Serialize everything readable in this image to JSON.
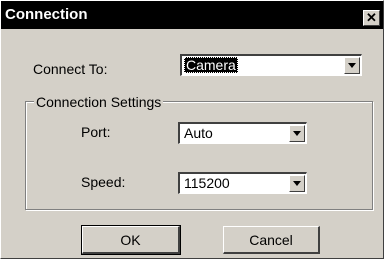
{
  "window": {
    "title": "Connection",
    "close_glyph": "✕"
  },
  "connect_to": {
    "label": "Connect To:",
    "value": "Camera"
  },
  "settings": {
    "legend": "Connection Settings",
    "port": {
      "label": "Port:",
      "value": "Auto"
    },
    "speed": {
      "label": "Speed:",
      "value": "115200"
    }
  },
  "buttons": {
    "ok": "OK",
    "cancel": "Cancel"
  },
  "icons": {
    "close": "close-icon",
    "dropdown": "chevron-down-icon"
  },
  "colors": {
    "title_bar": "#000000",
    "face": "#d4d0c8",
    "selection": "#000000"
  }
}
